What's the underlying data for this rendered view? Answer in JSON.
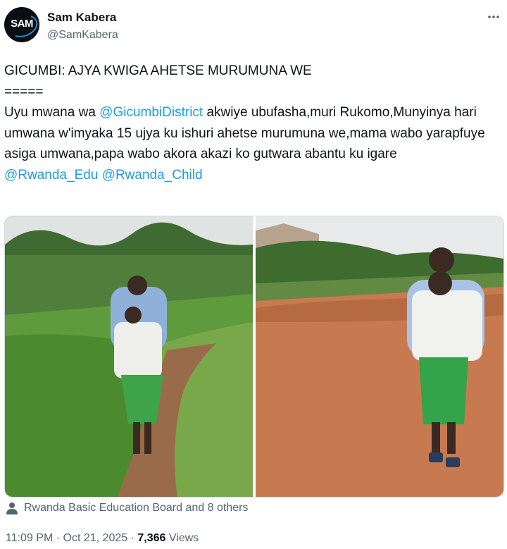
{
  "author": {
    "name": "Sam Kabera",
    "handle": "@SamKabera",
    "avatar_text": "SAM"
  },
  "tweet": {
    "title": "GICUMBI: AJYA KWIGA AHETSE MURUMUNA WE",
    "separator": "=====",
    "body_prefix": "Uyu mwana wa ",
    "body_mention": "@GicumbiDistrict",
    "body_suffix": " akwiye ubufasha,muri Rukomo,Munyinya hari umwana w'imyaka 15 ujya ku ishuri ahetse murumuna we,mama wabo yarapfuye asiga umwana,papa wabo akora akazi ko gutwara abantu ku igare",
    "mention_1": "@Rwanda_Edu",
    "mention_2": "@Rwanda_Child"
  },
  "liked_by": "Rwanda Basic Education Board and 8 others",
  "meta": {
    "time": "11:09 PM",
    "date": "Oct 21, 2025",
    "views_count": "7,366",
    "views_label": "Views",
    "dot": "·"
  },
  "icons": {
    "more": "more-icon",
    "person": "person-icon"
  }
}
